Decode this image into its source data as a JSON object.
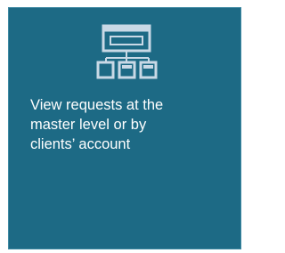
{
  "tile": {
    "lines": [
      "View requests at the",
      "master level or by",
      "clients’ account"
    ],
    "icon": "master-and-client-accounts-icon",
    "colors": {
      "background": "#1d6a85",
      "icon": "#c9d9e6",
      "text": "#ffffff"
    }
  }
}
